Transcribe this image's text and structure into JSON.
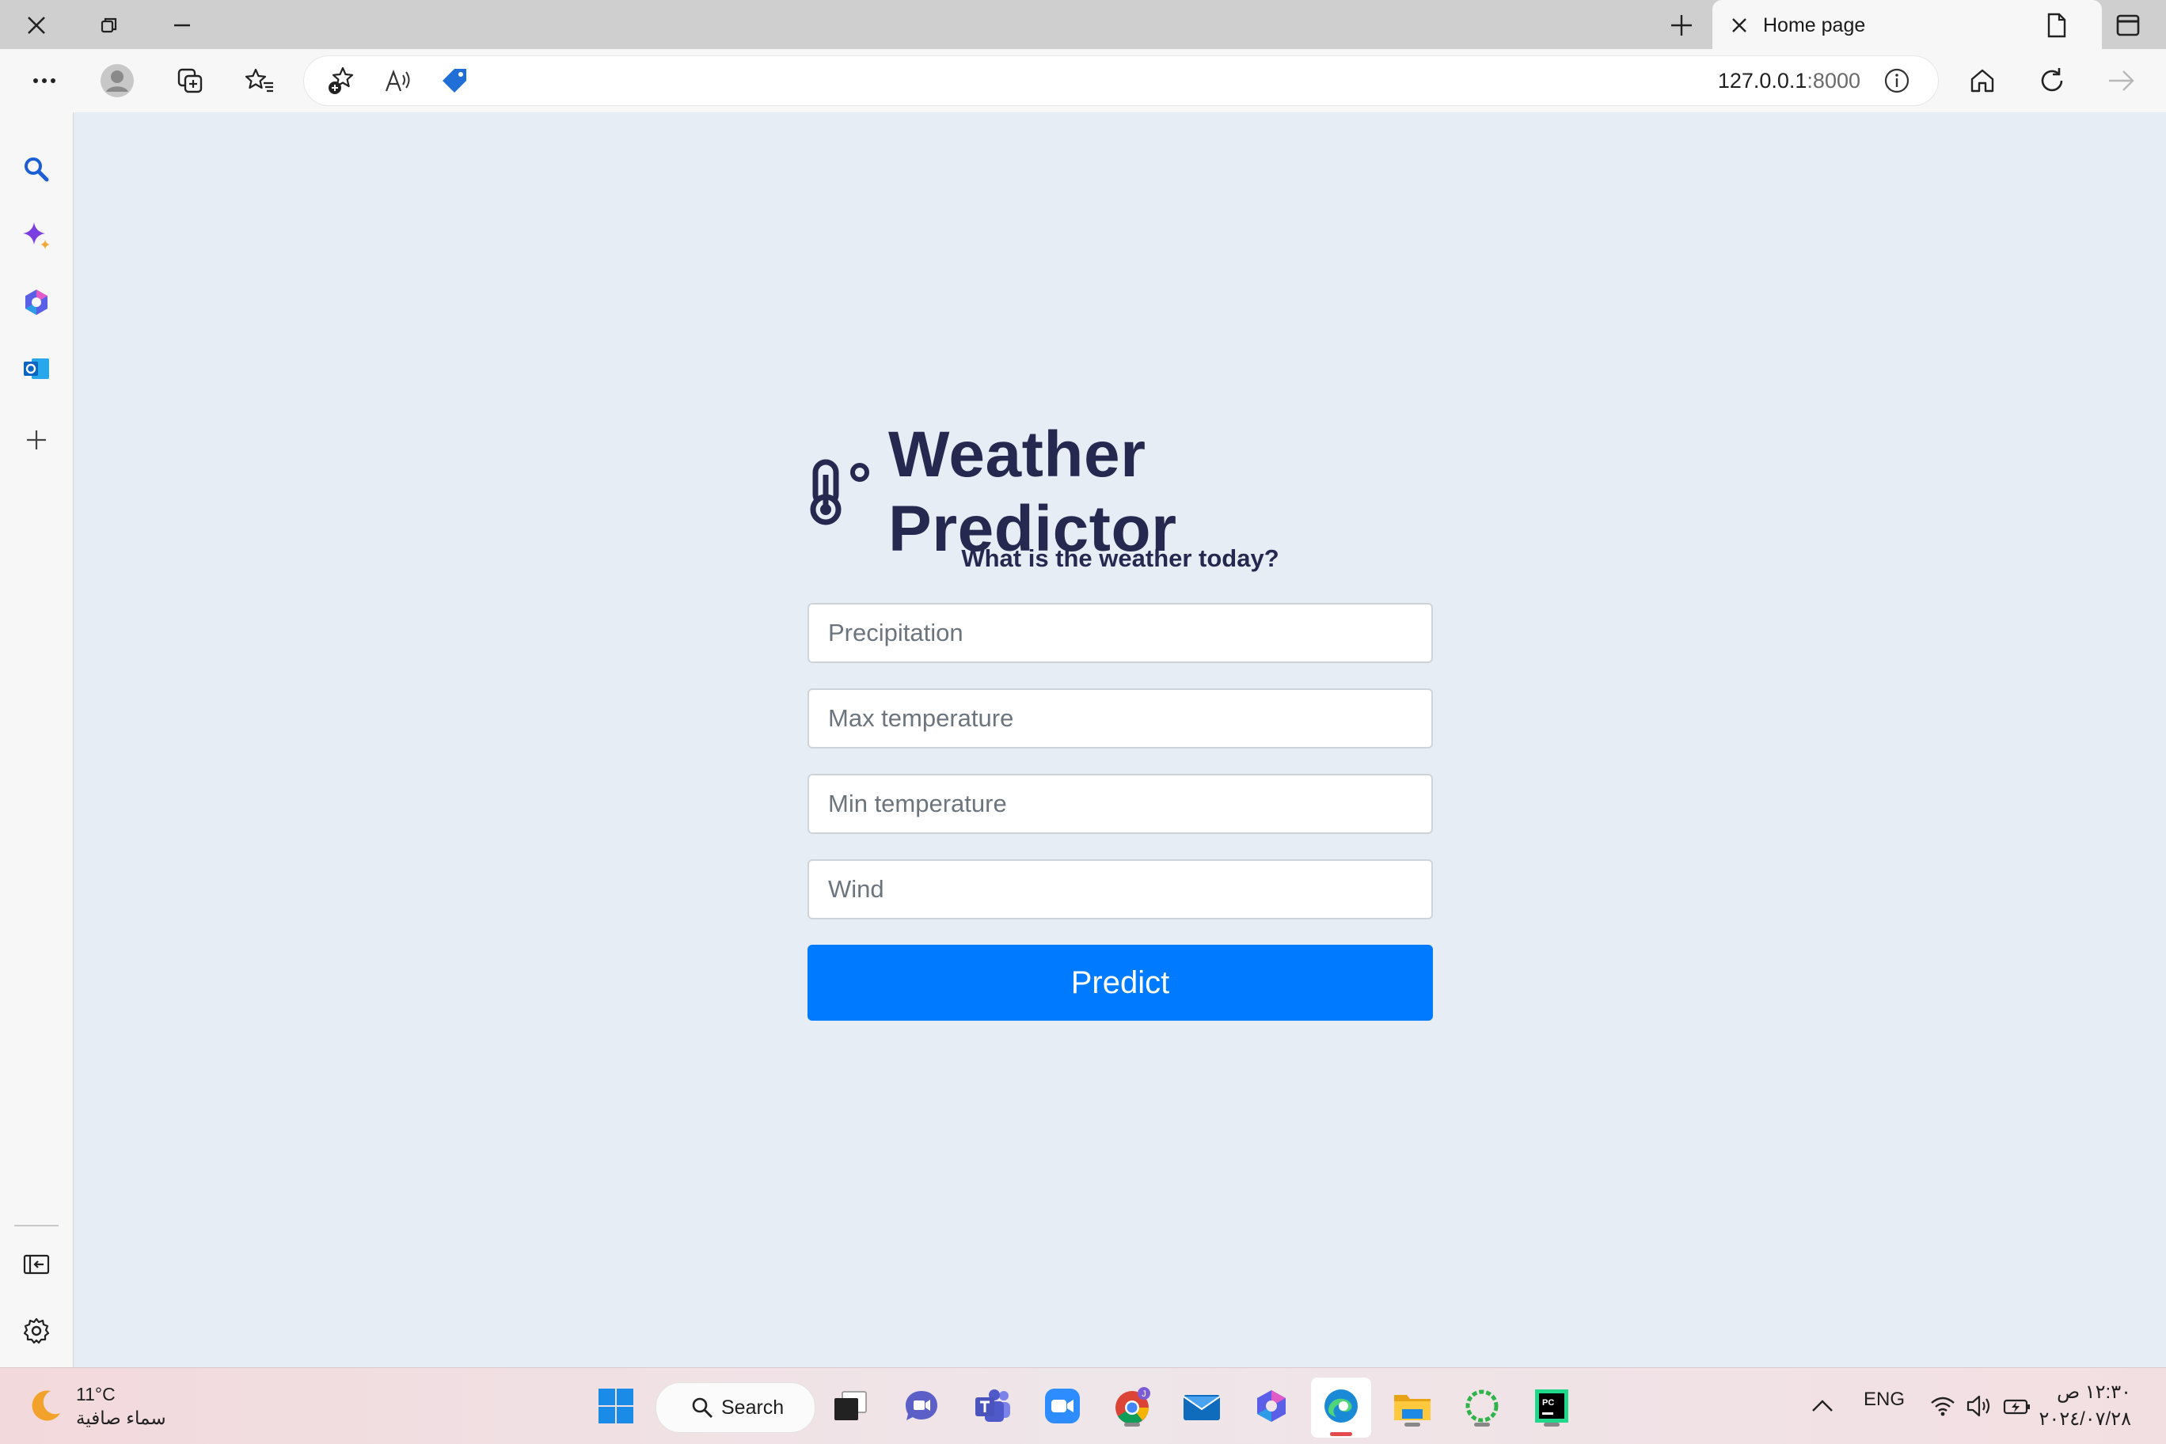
{
  "browser": {
    "tab_title": "Home page",
    "url_host": "127.0.0.1",
    "url_port": ":8000"
  },
  "page": {
    "heading": "Weather Predictor",
    "subheading": "What is the weather today?",
    "fields": {
      "precipitation_placeholder": "Precipitation",
      "max_temp_placeholder": "Max temperature",
      "min_temp_placeholder": "Min temperature",
      "wind_placeholder": "Wind"
    },
    "predict_label": "Predict"
  },
  "taskbar": {
    "weather_temp": "11°C",
    "weather_condition": "سماء صافية",
    "search_label": "Search",
    "language": "ENG",
    "time": "١٢:٣٠ ص",
    "date": "٢٠٢٤/٠٧/٢٨"
  },
  "colors": {
    "accent": "#007bff",
    "heading": "#26294f",
    "page_bg": "#e7edf5"
  }
}
